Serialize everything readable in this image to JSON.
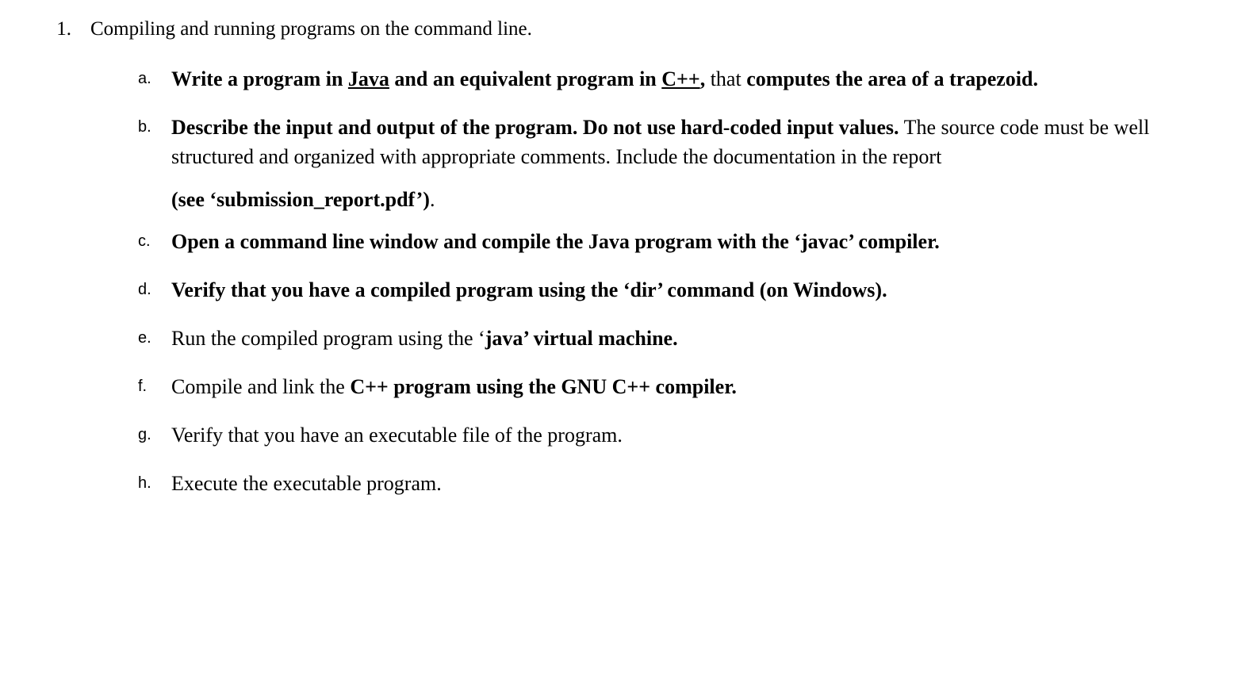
{
  "main": {
    "marker": "1.",
    "title": "Compiling and running programs on the command line."
  },
  "items": {
    "a": {
      "marker": "a.",
      "p1_bold": "Write a program in ",
      "p1_java": "Java",
      "p2_bold": " and an equivalent program in ",
      "p2_cpp": "C++",
      "p2_comma": ",",
      "p3_plain": " that ",
      "p4_bold": "computes the area of a trapezoid."
    },
    "b": {
      "marker": "b.",
      "p1_bold": "Describe the input and output of the program. Do not use hard-coded input values.",
      "p2_plain": " The source code must be well structured and organized with appropriate comments. Include the documentation in the report",
      "p3_bold": "(see ‘submission_report.pdf’)",
      "p3_dot": "."
    },
    "c": {
      "marker": "c.",
      "p1_bold": "Open a command line window and compile the Java program with the ‘javac’ compiler."
    },
    "d": {
      "marker": "d.",
      "p1_bold": "Verify that you have a compiled program using the ‘dir’ command (on Windows)."
    },
    "e": {
      "marker": "e.",
      "p1_plain": "Run the compiled program using the ‘",
      "p1_bold": "java’ virtual machine."
    },
    "f": {
      "marker": "f.",
      "p1_plain": "Compile and link the ",
      "p1_bold": "C++ program using the GNU C++ compiler."
    },
    "g": {
      "marker": "g.",
      "p1_plain": "Verify that you have an executable file of the program."
    },
    "h": {
      "marker": "h.",
      "p1_plain": "Execute the executable program."
    }
  }
}
